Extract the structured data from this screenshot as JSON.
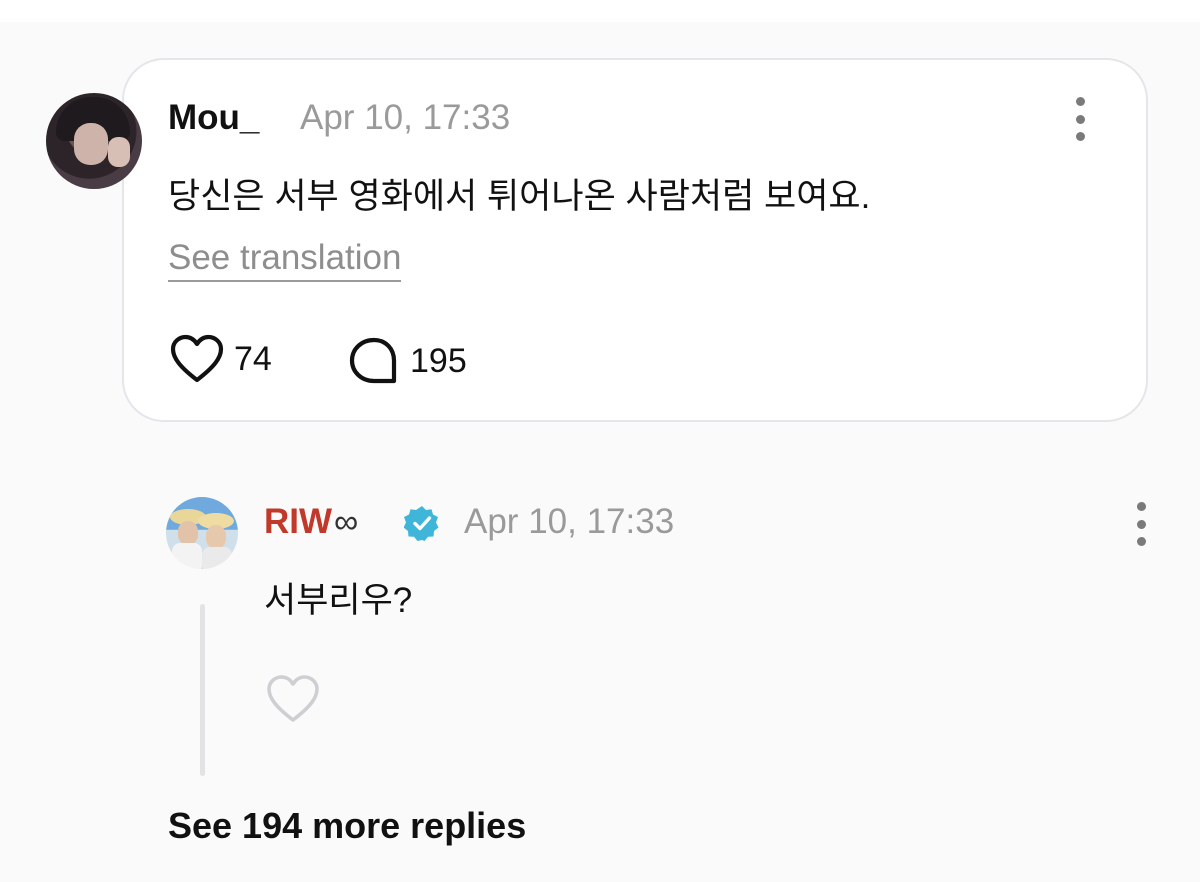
{
  "comment": {
    "username": "Mou_",
    "timestamp": "Apr 10, 17:33",
    "text": "당신은 서부 영화에서 튀어나온 사람처럼 보여요.",
    "translate_label": "See translation",
    "likes": "74",
    "replies": "195",
    "icons": {
      "like": "heart-icon",
      "reply": "speech-bubble-icon",
      "more": "more-vertical-icon"
    }
  },
  "reply": {
    "username": "RIW",
    "username_suffix": "∞",
    "verified": true,
    "timestamp": "Apr 10, 17:33",
    "text": "서부리우?",
    "icons": {
      "like": "heart-outline-icon",
      "more": "more-vertical-icon",
      "badge": "verified-badge-icon"
    }
  },
  "see_more_label": "See 194 more replies",
  "colors": {
    "background": "#fafafb",
    "card_border": "#e6e6ea",
    "reply_name": "#c0392b",
    "verified_badge": "#3fb5d9",
    "muted_text": "#9a9a9a"
  }
}
